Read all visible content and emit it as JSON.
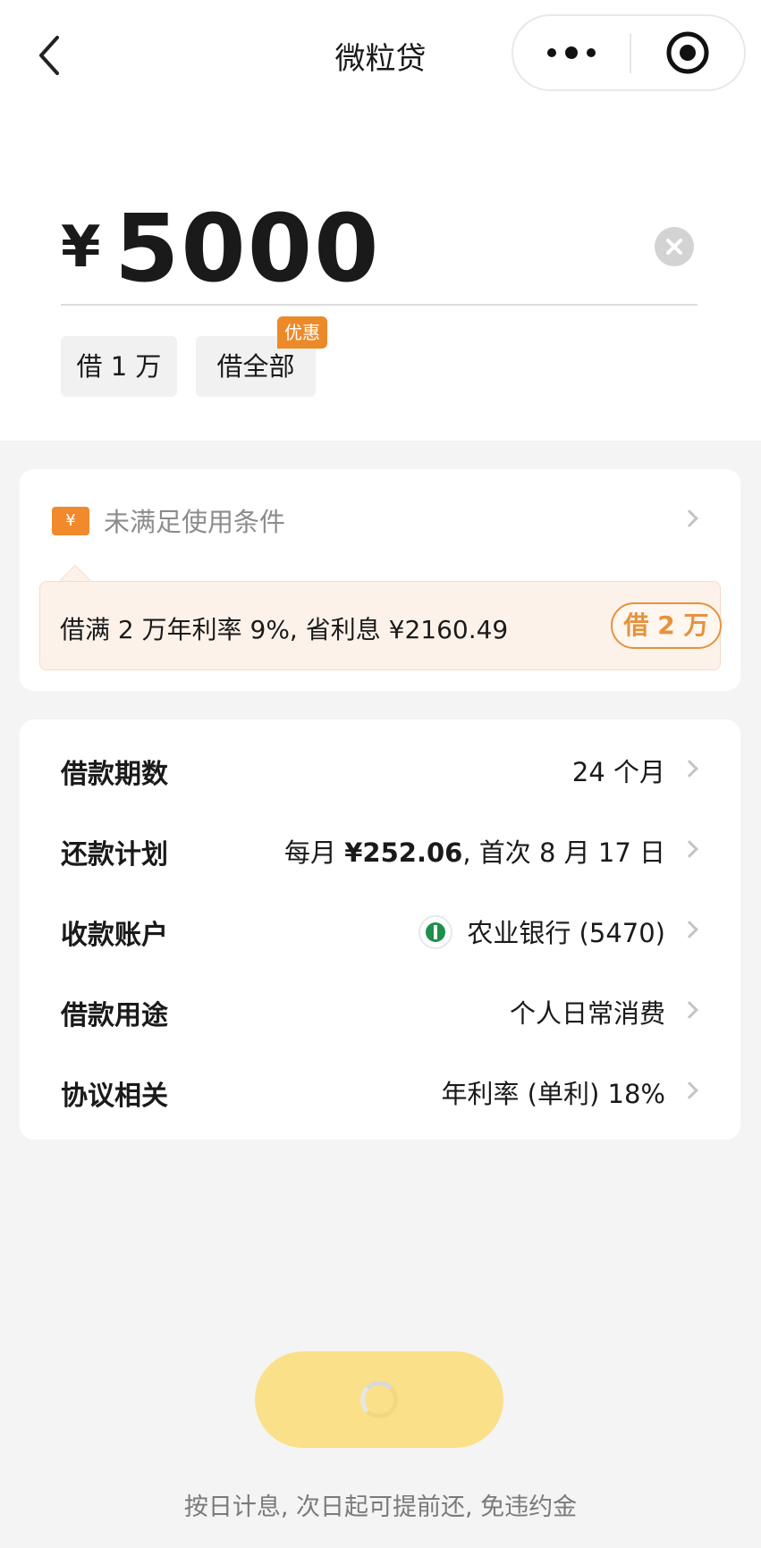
{
  "nav": {
    "title": "微粒贷"
  },
  "amount": {
    "currency": "¥",
    "value": "5000"
  },
  "quick_options": {
    "borrow_10k": "借 1 万",
    "borrow_all": "借全部",
    "promo_badge": "优惠"
  },
  "coupon": {
    "status_text": "未满足使用条件",
    "icon_symbol": "¥"
  },
  "upsell": {
    "text": "借满 2 万年利率 9%, 省利息 ¥2160.49",
    "button_label": "借 2 万"
  },
  "details": [
    {
      "label": "借款期数",
      "value": "24 个月"
    },
    {
      "label": "还款计划",
      "value_prefix": "每月 ",
      "value_strong": "¥252.06",
      "value_suffix": ", 首次 8 月 17 日"
    },
    {
      "label": "收款账户",
      "value": "农业银行 (5470)"
    },
    {
      "label": "借款用途",
      "value": "个人日常消费"
    },
    {
      "label": "协议相关",
      "value": "年利率 (单利) 18%"
    }
  ],
  "footer": {
    "note": "按日计息, 次日起可提前还, 免违约金"
  },
  "colors": {
    "accent_orange": "#ec8a2a",
    "button_yellow": "#fbe08a",
    "bank_green": "#1f8f4c"
  }
}
